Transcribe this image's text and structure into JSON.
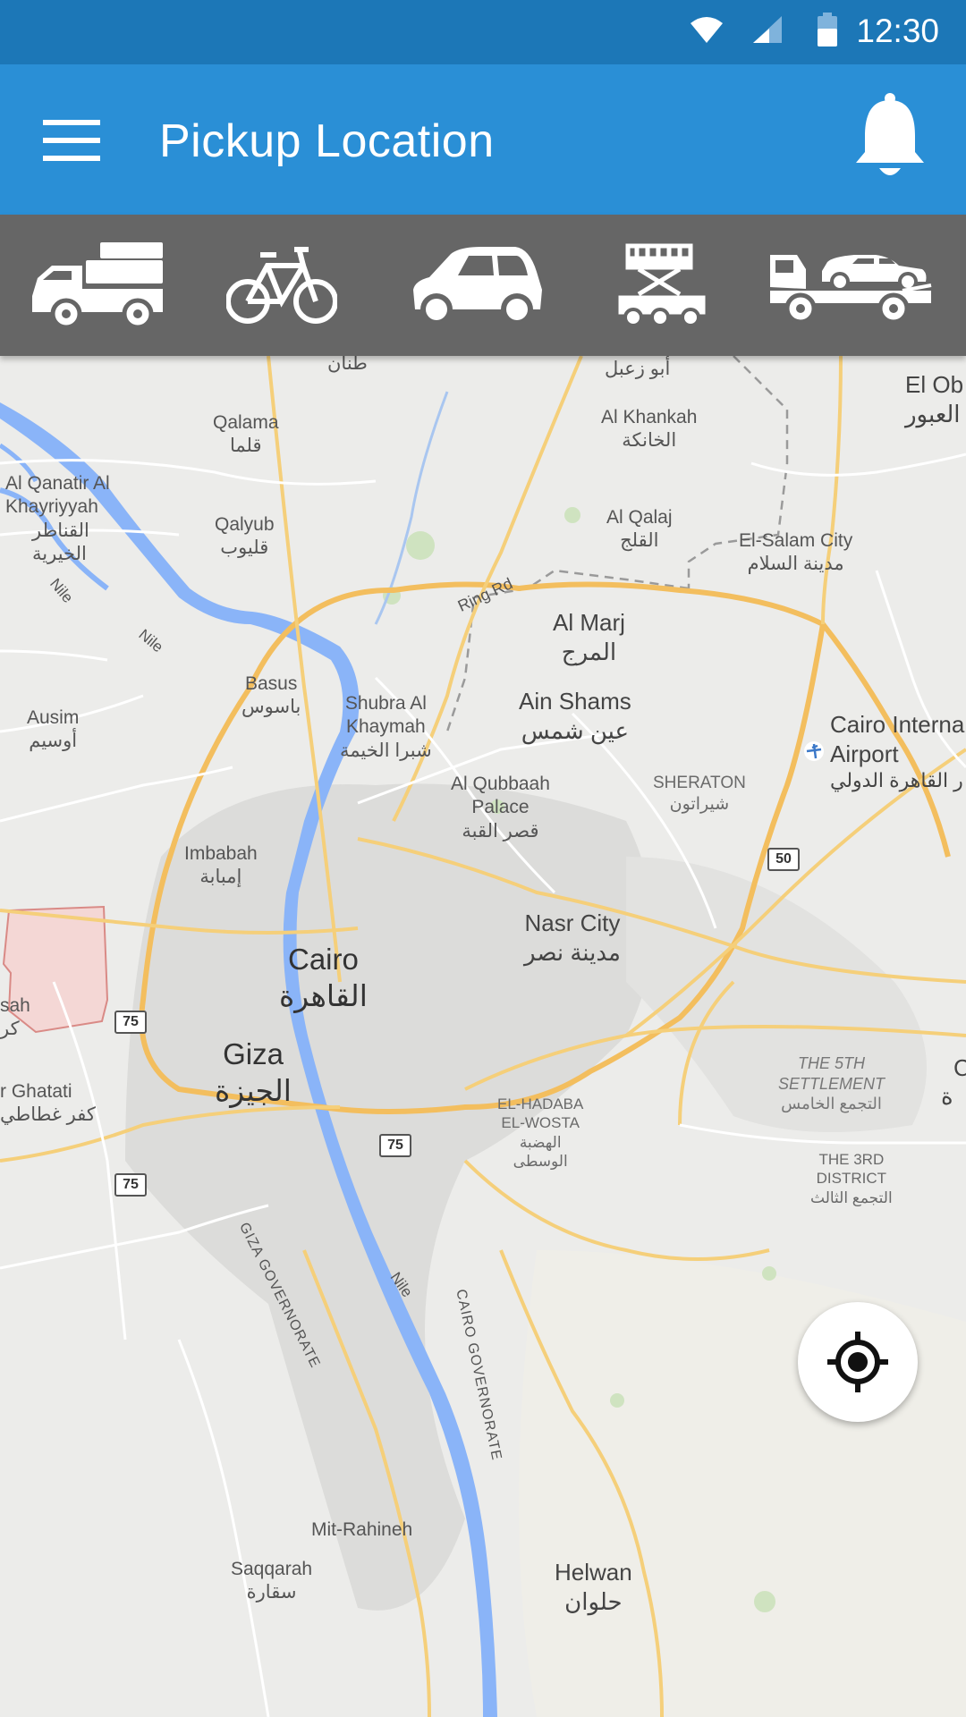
{
  "status_bar": {
    "time": "12:30"
  },
  "app_bar": {
    "title": "Pickup Location"
  },
  "vehicles": [
    {
      "name": "pickup-truck"
    },
    {
      "name": "bicycle"
    },
    {
      "name": "car"
    },
    {
      "name": "scissor-lift-truck"
    },
    {
      "name": "tow-truck"
    }
  ],
  "map": {
    "labels": {
      "tanan": "طنان",
      "abu_zaabal": "أبو زعبل",
      "el_obour_en": "El Ob",
      "el_obour_ar": "العبور",
      "qalama_en": "Qalama",
      "qalama_ar": "قلما",
      "khankah_en": "Al Khankah",
      "khankah_ar": "الخانكة",
      "qanatir_en1": "Al Qanatir Al",
      "qanatir_en2": "Khayriyyah",
      "qanatir_ar1": "القناطر",
      "qanatir_ar2": "الخيرية",
      "qalyub_en": "Qalyub",
      "qalyub_ar": "قليوب",
      "qalaj_en": "Al Qalaj",
      "qalaj_ar": "القلج",
      "salam_en": "El-Salam City",
      "salam_ar": "مدينة السلام",
      "ring_rd": "Ring Rd",
      "marj_en": "Al Marj",
      "marj_ar": "المرج",
      "nile_1": "Nile",
      "nile_2": "Nile",
      "nile_3": "Nile",
      "basus_en": "Basus",
      "basus_ar": "باسوس",
      "shubra_en1": "Shubra Al",
      "shubra_en2": "Khaymah",
      "shubra_ar": "شبرا الخيمة",
      "ain_shams_en": "Ain Shams",
      "ain_shams_ar": "عين شمس",
      "airport_en1": "Cairo Interna",
      "airport_en2": "Airport",
      "airport_ar": "ر القاهرة الدولي",
      "ausim_en": "Ausim",
      "ausim_ar": "أوسيم",
      "qubbaah_en1": "Al Qubbaah",
      "qubbaah_en2": "Palace",
      "qubbaah_ar": "قصر القبة",
      "sheraton_en": "SHERATON",
      "sheraton_ar": "شيراتون",
      "imbabah_en": "Imbabah",
      "imbabah_ar": "إمبابة",
      "nasr_en": "Nasr City",
      "nasr_ar": "مدينة نصر",
      "cairo_en": "Cairo",
      "cairo_ar": "القاهرة",
      "sah": "sah",
      "kur": "كر",
      "giza_en": "Giza",
      "giza_ar": "الجيزة",
      "ghatati_en": "r Ghatati",
      "ghatati_ar": "كفر غطاطي",
      "fifth_en1": "THE 5TH",
      "fifth_en2": "SETTLEMENT",
      "fifth_ar": "التجمع الخامس",
      "hadaba_en1": "EL-HADABA",
      "hadaba_en2": "EL-WOSTA",
      "hadaba_ar1": "الهضبة",
      "hadaba_ar2": "الوسطى",
      "third_en1": "THE 3RD",
      "third_en2": "DISTRICT",
      "third_ar": "التجمع الثالث",
      "giza_gov": "GIZA GOVERNORATE",
      "cairo_gov": "CAIRO GOVERNORATE",
      "mit_rahineh": "Mit-Rahineh",
      "saqqarah_en": "Saqqarah",
      "saqqarah_ar": "سقارة",
      "helwan_en": "Helwan",
      "helwan_ar": "حلوان",
      "edge_c": "C",
      "edge_ar": "ة"
    },
    "shields": {
      "s50": "50",
      "s75a": "75",
      "s75b": "75",
      "s75c": "75"
    }
  },
  "colors": {
    "status_bar": "#1c77b7",
    "app_bar": "#2a8fd6",
    "vehicle_bar": "#666666",
    "water": "#8ab4f8",
    "road_major": "#f5c76a"
  }
}
